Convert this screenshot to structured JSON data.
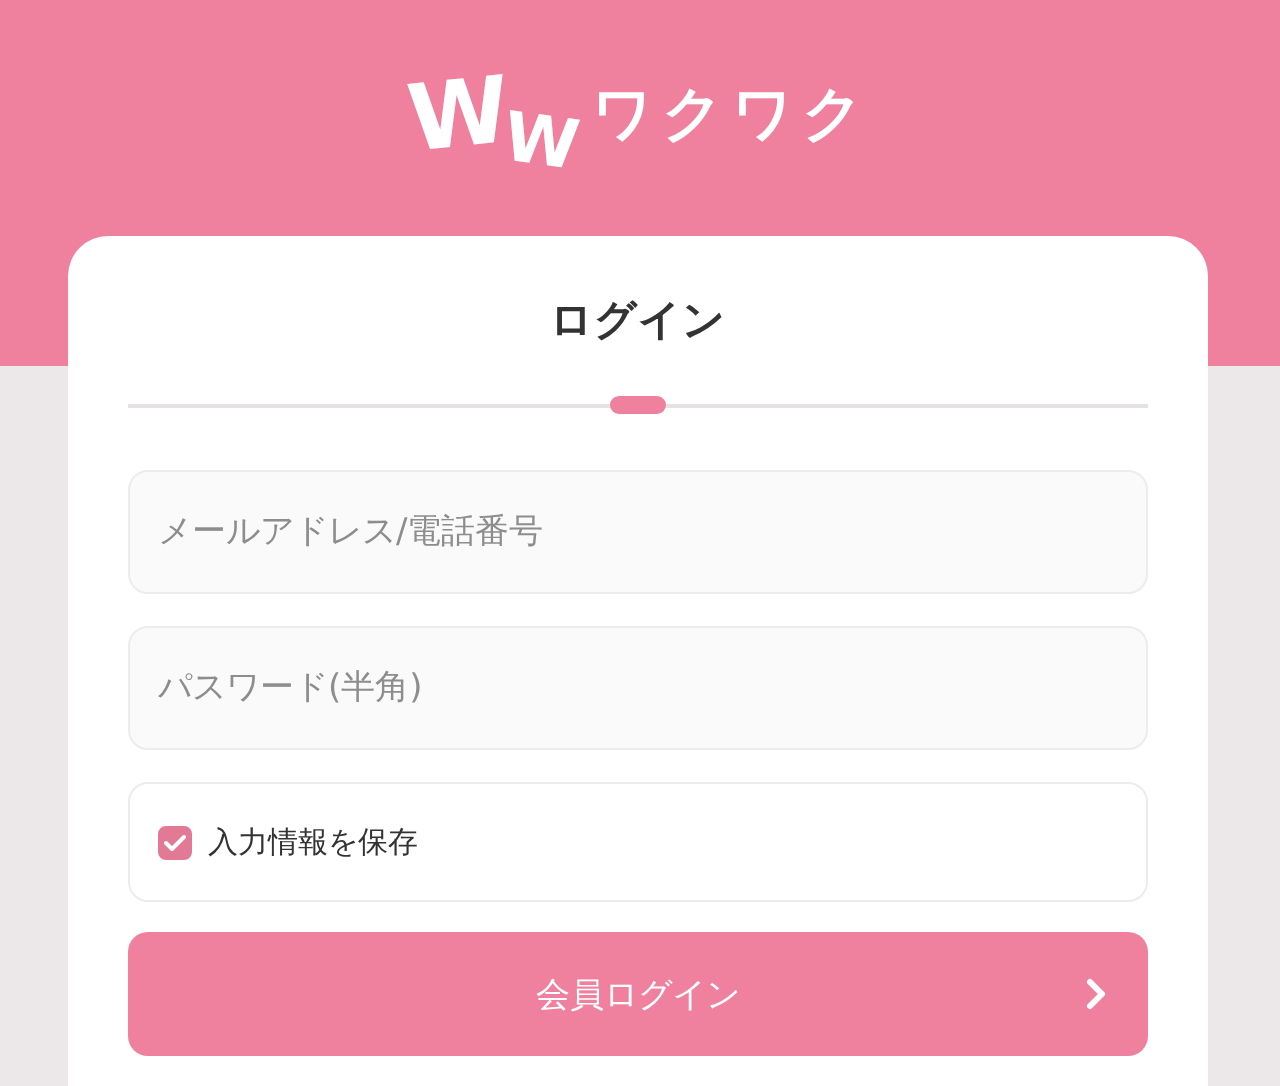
{
  "logo": {
    "mark": "WW",
    "text": "ワクワク"
  },
  "login_card": {
    "title": "ログイン",
    "fields": [
      {
        "placeholder": "メールアドレス/電話番号"
      },
      {
        "placeholder": "パスワード(半角)"
      }
    ],
    "remember": {
      "label": "入力情報を保存",
      "checked": true
    },
    "submit_button": {
      "label": "会員ログイン"
    }
  }
}
